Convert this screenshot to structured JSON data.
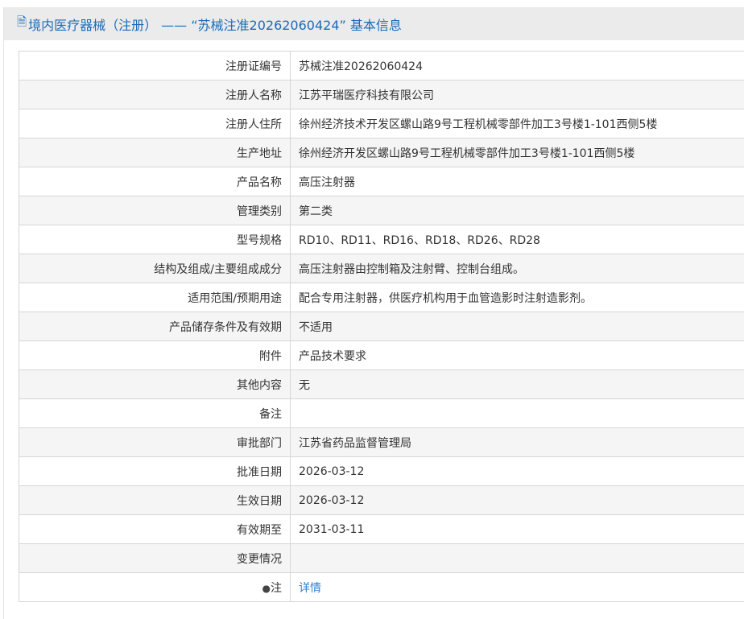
{
  "title": "境内医疗器械（注册） —— “苏械注准20262060424” 基本信息",
  "rows": [
    {
      "label": "注册证编号",
      "value": "苏械注准20262060424"
    },
    {
      "label": "注册人名称",
      "value": "江苏平瑞医疗科技有限公司"
    },
    {
      "label": "注册人住所",
      "value": "徐州经济技术开发区螺山路9号工程机械零部件加工3号楼1-101西侧5楼"
    },
    {
      "label": "生产地址",
      "value": "徐州经济开发区螺山路9号工程机械零部件加工3号楼1-101西侧5楼"
    },
    {
      "label": "产品名称",
      "value": "高压注射器"
    },
    {
      "label": "管理类别",
      "value": "第二类"
    },
    {
      "label": "型号规格",
      "value": "RD10、RD11、RD16、RD18、RD26、RD28"
    },
    {
      "label": "结构及组成/主要组成成分",
      "value": "高压注射器由控制箱及注射臂、控制台组成。"
    },
    {
      "label": "适用范围/预期用途",
      "value": "配合专用注射器，供医疗机构用于血管造影时注射造影剂。"
    },
    {
      "label": "产品储存条件及有效期",
      "value": "不适用"
    },
    {
      "label": "附件",
      "value": "产品技术要求"
    },
    {
      "label": "其他内容",
      "value": "无"
    },
    {
      "label": "备注",
      "value": ""
    },
    {
      "label": "审批部门",
      "value": "江苏省药品监督管理局"
    },
    {
      "label": "批准日期",
      "value": "2026-03-12"
    },
    {
      "label": "生效日期",
      "value": "2026-03-12"
    },
    {
      "label": "有效期至",
      "value": "2031-03-11"
    },
    {
      "label": "变更情况",
      "value": ""
    }
  ],
  "note": {
    "label": "注",
    "link": "详情"
  }
}
